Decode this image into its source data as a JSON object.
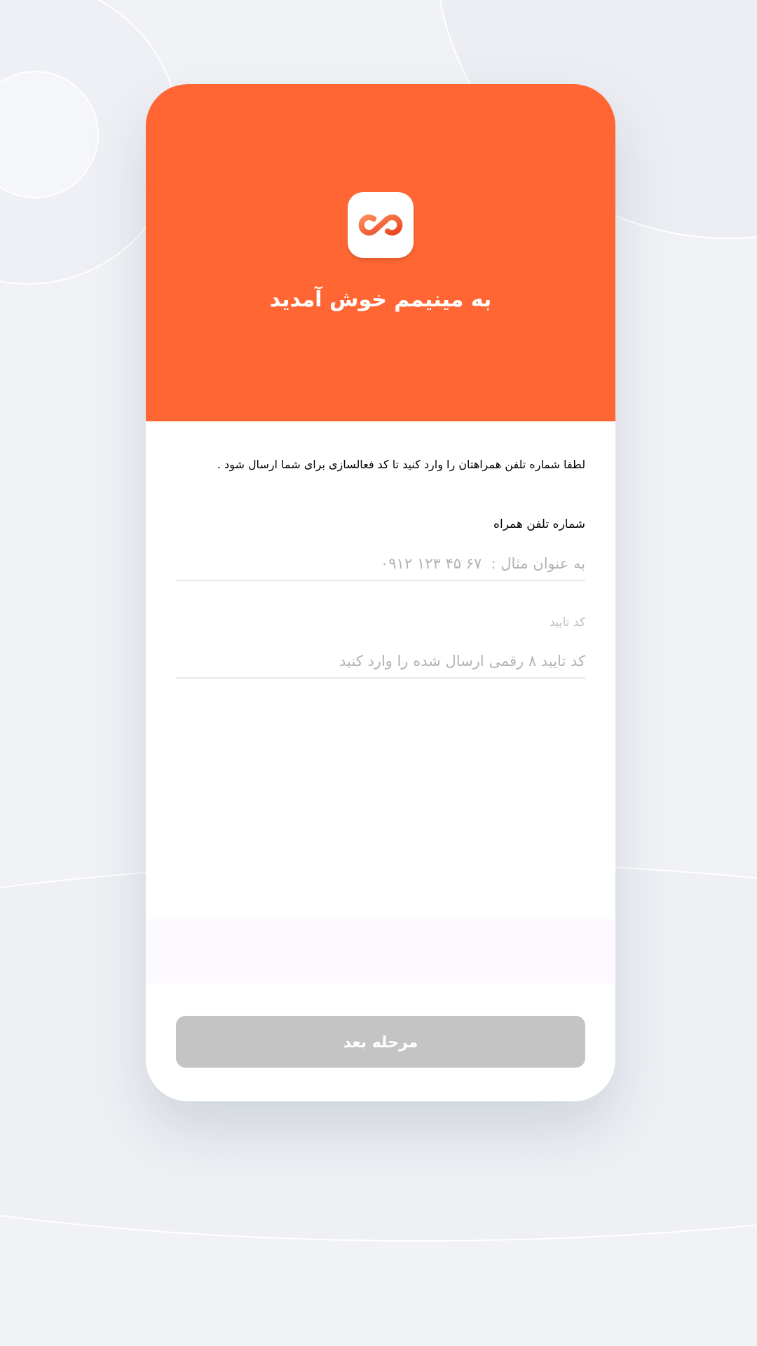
{
  "header": {
    "title": "به مینیمم خوش آمدید"
  },
  "intro": "لطفا شماره تلفن همراهتان را وارد کنید تا کد فعالسازی برای شما ارسال شود .",
  "fields": [
    {
      "label": "شماره تلفن همراه",
      "placeholder": "به عنوان مثال :  ۶۷ ۴۵ ۱۲۳ ۰۹۱۲",
      "disabled": false
    },
    {
      "label": "کد تایید",
      "placeholder": "کد تایید ۸ رقمی ارسال شده را وارد کنید",
      "disabled": true
    }
  ],
  "next_button": {
    "label": "مرحله بعد",
    "disabled": true
  }
}
